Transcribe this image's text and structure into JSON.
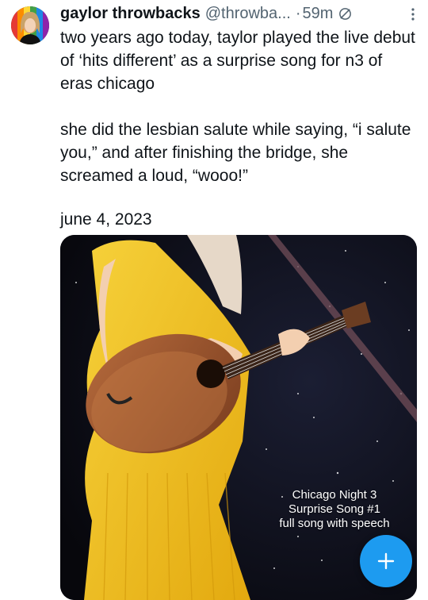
{
  "tweet": {
    "author_name": "gaylor throwbacks",
    "author_handle": "@throwba...",
    "dot": "·",
    "time": "59m",
    "body_p1": "two years ago today, taylor played the live debut of ‘hits different’ as a surprise song for n3 of eras chicago",
    "body_p2": "she did the lesbian salute while saying, “i salute you,” and after finishing the bridge, she screamed a loud, “wooo!”",
    "date_line": "june 4, 2023"
  },
  "media": {
    "caption_line1": "Chicago Night 3",
    "caption_line2": "Surprise Song #1",
    "caption_line3": "full song with speech"
  },
  "fab": {
    "label": "+"
  },
  "colors": {
    "accent": "#1d9bf0",
    "text": "#0f1419",
    "secondary": "#536471",
    "dress": "#f2c21a"
  },
  "icons": {
    "more": "more-options-icon",
    "do_not_disturb": "circle-slash-icon",
    "compose": "plus-icon"
  }
}
